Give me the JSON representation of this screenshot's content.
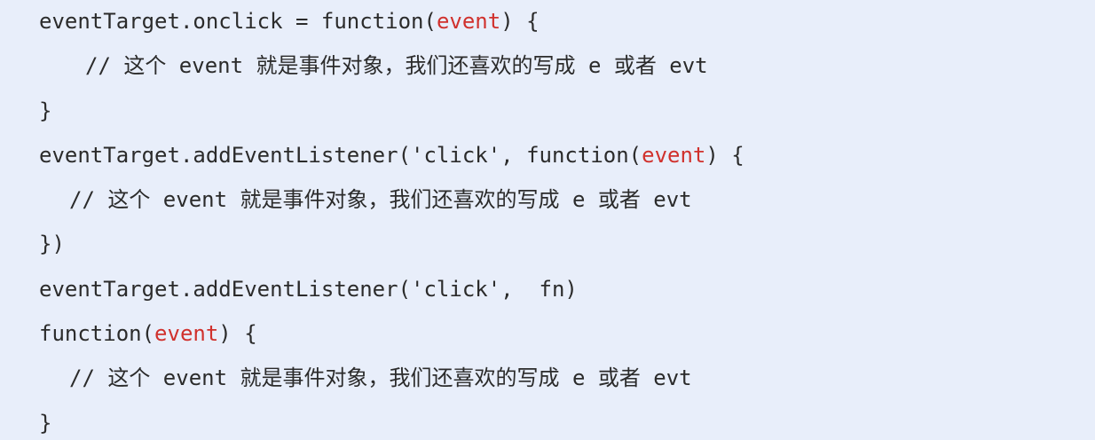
{
  "code": {
    "lines": [
      {
        "before": "eventTarget.onclick = function(",
        "param": "event",
        "after": ") {"
      },
      {
        "text": "// 这个 event 就是事件对象，我们还喜欢的写成 e 或者 evt"
      },
      {
        "text": "}"
      },
      {
        "before": "eventTarget.addEventListener('click', function(",
        "param": "event",
        "after": ") {"
      },
      {
        "text": "// 这个 event 就是事件对象，我们还喜欢的写成 e 或者 evt"
      },
      {
        "text": "})"
      },
      {
        "text": "eventTarget.addEventListener('click',  fn)"
      },
      {
        "before": "function(",
        "param": "event",
        "after": ") {"
      },
      {
        "text": "// 这个 event 就是事件对象，我们还喜欢的写成 e 或者 evt"
      },
      {
        "text": "}"
      }
    ]
  },
  "colors": {
    "background": "#e8eefa",
    "text": "#2b2b2b",
    "parameter": "#d0312d"
  }
}
